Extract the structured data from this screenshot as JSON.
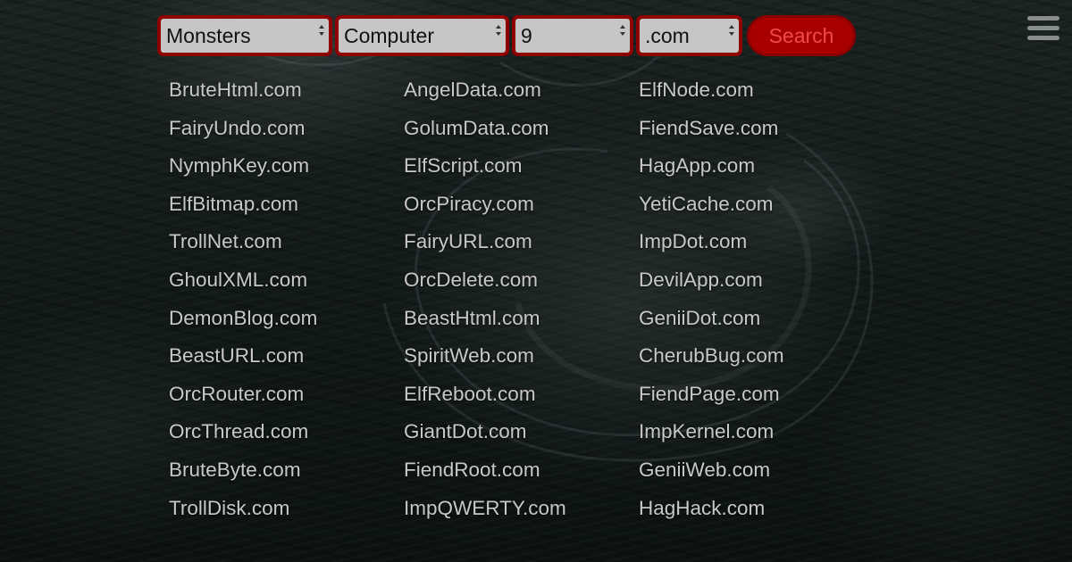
{
  "search": {
    "category_value": "Monsters",
    "topic_value": "Computer",
    "length_value": "9",
    "tld_value": ".com",
    "button_label": "Search"
  },
  "menu": {
    "icon": "hamburger-menu-icon"
  },
  "colors": {
    "accent_red": "#a80000",
    "select_border": "#8f0000",
    "button_text": "#f14a4a",
    "link_text": "#c8c8c8"
  },
  "results": {
    "columns": [
      [
        "BruteHtml.com",
        "FairyUndo.com",
        "NymphKey.com",
        "ElfBitmap.com",
        "TrollNet.com",
        "GhoulXML.com",
        "DemonBlog.com",
        "BeastURL.com",
        "OrcRouter.com",
        "OrcThread.com",
        "BruteByte.com",
        "TrollDisk.com"
      ],
      [
        "AngelData.com",
        "GolumData.com",
        "ElfScript.com",
        "OrcPiracy.com",
        "FairyURL.com",
        "OrcDelete.com",
        "BeastHtml.com",
        "SpiritWeb.com",
        "ElfReboot.com",
        "GiantDot.com",
        "FiendRoot.com",
        "ImpQWERTY.com"
      ],
      [
        "ElfNode.com",
        "FiendSave.com",
        "HagApp.com",
        "YetiCache.com",
        "ImpDot.com",
        "DevilApp.com",
        "GeniiDot.com",
        "CherubBug.com",
        "FiendPage.com",
        "ImpKernel.com",
        "GeniiWeb.com",
        "HagHack.com"
      ]
    ]
  }
}
